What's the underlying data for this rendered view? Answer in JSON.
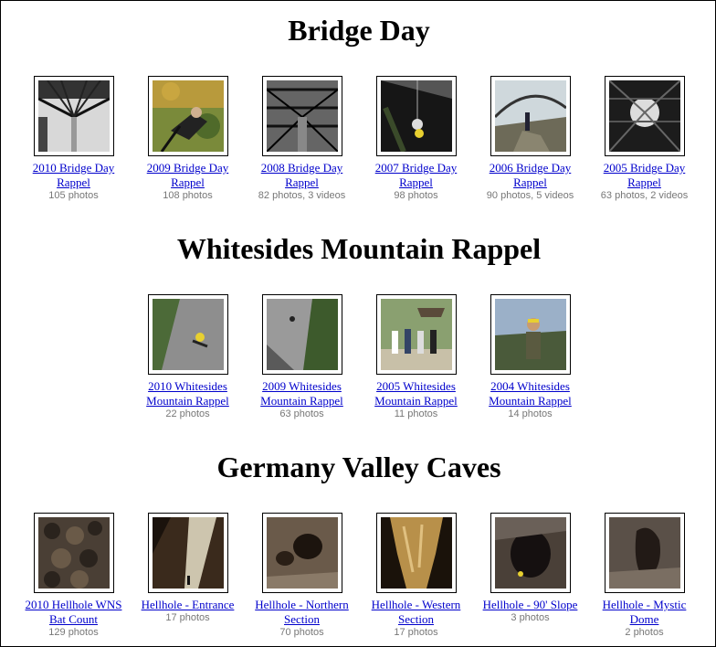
{
  "sections": [
    {
      "title": "Bridge Day",
      "albums": [
        {
          "label": "2010 Bridge Day Rappel",
          "count": "105 photos"
        },
        {
          "label": "2009 Bridge Day Rappel",
          "count": "108 photos"
        },
        {
          "label": "2008 Bridge Day Rappel",
          "count": "82 photos, 3 videos"
        },
        {
          "label": "2007 Bridge Day Rappel",
          "count": "98 photos"
        },
        {
          "label": "2006 Bridge Day Rappel",
          "count": "90 photos, 5 videos"
        },
        {
          "label": "2005 Bridge Day Rappel",
          "count": "63 photos, 2 videos"
        }
      ]
    },
    {
      "title": "Whitesides Mountain Rappel",
      "albums": [
        {
          "label": "2010 Whitesides Mountain Rappel",
          "count": "22 photos"
        },
        {
          "label": "2009 Whitesides Mountain Rappel",
          "count": "63 photos"
        },
        {
          "label": "2005 Whitesides Mountain Rappel",
          "count": "11 photos"
        },
        {
          "label": "2004 Whitesides Mountain Rappel",
          "count": "14 photos"
        }
      ]
    },
    {
      "title": "Germany Valley Caves",
      "albums": [
        {
          "label": "2010 Hellhole WNS Bat Count",
          "count": "129 photos"
        },
        {
          "label": "Hellhole - Entrance",
          "count": "17 photos"
        },
        {
          "label": "Hellhole - Northern Section",
          "count": "70 photos"
        },
        {
          "label": "Hellhole - Western Section",
          "count": "17 photos"
        },
        {
          "label": "Hellhole - 90' Slope",
          "count": "3 photos"
        },
        {
          "label": "Hellhole - Mystic Dome",
          "count": "2 photos"
        }
      ]
    }
  ],
  "colors": {
    "link": "#0000cc",
    "count": "#777777",
    "border": "#000000"
  }
}
